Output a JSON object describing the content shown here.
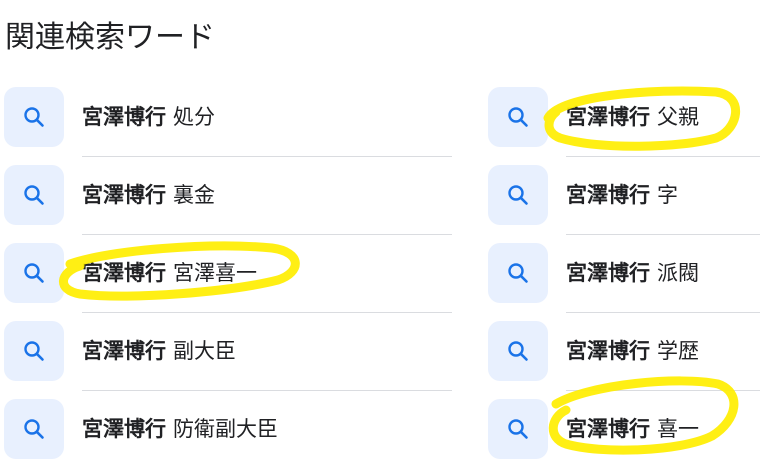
{
  "section": {
    "title": "関連検索ワード"
  },
  "colors": {
    "icon_bg": "#e8f0fe",
    "icon_stroke": "#1a73e8",
    "highlight": "#ffee00",
    "divider": "#dadce0"
  },
  "left_items": [
    {
      "keyword": "宮澤博行",
      "suffix": "処分",
      "icon": "search-icon"
    },
    {
      "keyword": "宮澤博行",
      "suffix": "裏金",
      "icon": "search-icon"
    },
    {
      "keyword": "宮澤博行",
      "suffix": "宮澤喜一",
      "icon": "search-icon"
    },
    {
      "keyword": "宮澤博行",
      "suffix": "副大臣",
      "icon": "search-icon"
    },
    {
      "keyword": "宮澤博行",
      "suffix": "防衛副大臣",
      "icon": "search-icon"
    }
  ],
  "right_items": [
    {
      "keyword": "宮澤博行",
      "suffix": "父親",
      "icon": "search-icon"
    },
    {
      "keyword": "宮澤博行",
      "suffix": "字",
      "icon": "search-icon"
    },
    {
      "keyword": "宮澤博行",
      "suffix": "派閥",
      "icon": "search-icon"
    },
    {
      "keyword": "宮澤博行",
      "suffix": "学歴",
      "icon": "search-icon"
    },
    {
      "keyword": "宮澤博行",
      "suffix": "喜一",
      "icon": "search-icon"
    }
  ]
}
